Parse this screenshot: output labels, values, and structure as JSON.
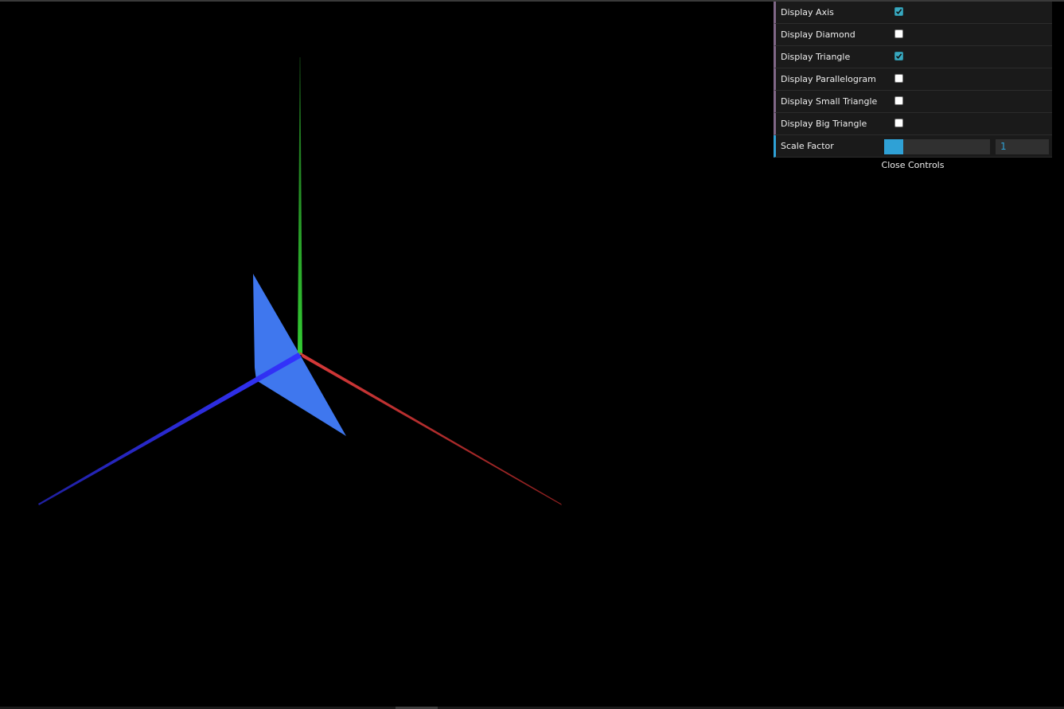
{
  "gui": {
    "controls": [
      {
        "label": "Display Axis",
        "checked": true
      },
      {
        "label": "Display Diamond",
        "checked": false
      },
      {
        "label": "Display Triangle",
        "checked": true
      },
      {
        "label": "Display Parallelogram",
        "checked": false
      },
      {
        "label": "Display Small Triangle",
        "checked": false
      },
      {
        "label": "Display Big Triangle",
        "checked": false
      }
    ],
    "scale_factor": {
      "label": "Scale Factor",
      "value": "1",
      "fill_fraction": 0.18
    },
    "close_label": "Close Controls"
  },
  "scene": {
    "background": "#000000",
    "axis_colors": {
      "x": "#c83232",
      "y": "#2ec82e",
      "z": "#3333ee"
    },
    "triangle_color": "#3f77ee"
  }
}
